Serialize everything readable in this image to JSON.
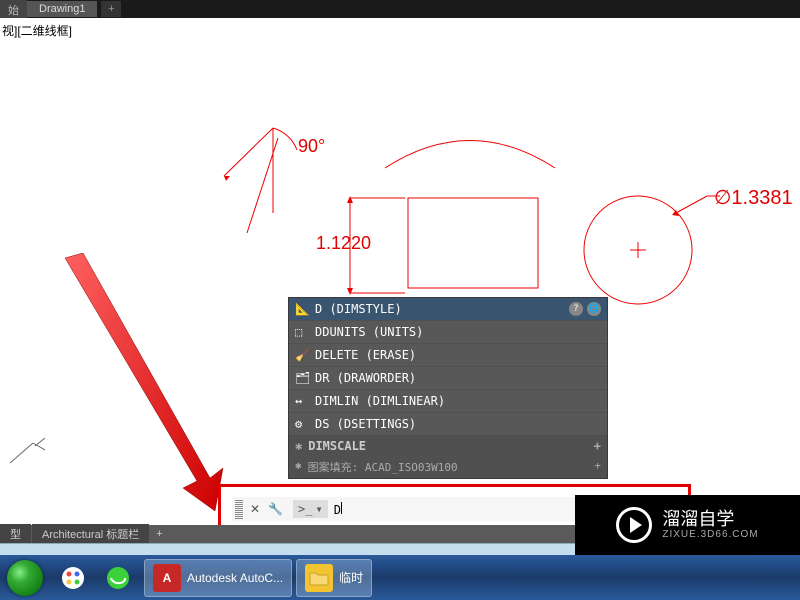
{
  "tabs": {
    "partial": "始",
    "active": "Drawing1",
    "add": "+"
  },
  "view_label": "视][二维线框]",
  "cad": {
    "angle_label": "90°",
    "dim_label": "1.1220",
    "diameter_label": "∅1.3381"
  },
  "autocomplete": {
    "items": [
      {
        "cmd": "D (DIMSTYLE)",
        "hl": true
      },
      {
        "cmd": "DDUNITS (UNITS)"
      },
      {
        "cmd": "DELETE (ERASE)"
      },
      {
        "cmd": "DR (DRAWORDER)"
      },
      {
        "cmd": "DIMLIN (DIMLINEAR)"
      },
      {
        "cmd": "DS (DSETTINGS)"
      }
    ],
    "section": "DIMSCALE",
    "hatch": "图案填充: ACAD_ISO03W100"
  },
  "cmdline": {
    "prompt": ">_",
    "dropdown": "▾",
    "value": "D"
  },
  "doc_tabs": {
    "t1": "型",
    "t2": "Architectural 标题栏",
    "add": "+",
    "r1": "模型"
  },
  "taskbar": {
    "app1": "Autodesk AutoC...",
    "app2": "临时",
    "app1_letter": "A"
  },
  "watermark": {
    "main": "溜溜自学",
    "sub": "ZIXUE.3D66.COM"
  }
}
